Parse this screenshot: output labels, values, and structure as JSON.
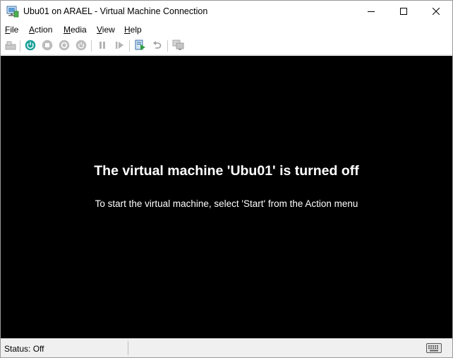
{
  "window": {
    "title": "Ubu01 on ARAEL - Virtual Machine Connection",
    "app_icon": "vm-connection-icon",
    "controls": [
      "minimize-icon",
      "maximize-icon",
      "close-icon"
    ]
  },
  "menu": {
    "items": [
      {
        "accel": "F",
        "rest": "ile"
      },
      {
        "accel": "A",
        "rest": "ction"
      },
      {
        "accel": "M",
        "rest": "edia"
      },
      {
        "accel": "V",
        "rest": "iew"
      },
      {
        "accel": "H",
        "rest": "elp"
      }
    ]
  },
  "toolbar": {
    "buttons": [
      {
        "icon": "ctrl-alt-del-icon",
        "enabled": false
      },
      {
        "icon": "start-icon",
        "enabled": true
      },
      {
        "icon": "turn-off-icon",
        "enabled": false
      },
      {
        "icon": "shut-down-icon",
        "enabled": false
      },
      {
        "icon": "save-icon",
        "enabled": false
      },
      {
        "icon": "pause-icon",
        "enabled": false
      },
      {
        "icon": "resume-icon",
        "enabled": false
      },
      {
        "icon": "checkpoint-icon",
        "enabled": true
      },
      {
        "icon": "revert-icon",
        "enabled": false
      },
      {
        "icon": "enhanced-session-icon",
        "enabled": false
      }
    ],
    "colors": {
      "start": "#1aa19a",
      "checkpoint": "#2e7d32",
      "disabled": "#b4b4b4"
    }
  },
  "screen": {
    "title": "The virtual machine 'Ubu01' is turned off",
    "subtitle": "To start the virtual machine, select 'Start' from the Action menu",
    "background": "#000000",
    "text_color": "#ffffff"
  },
  "status": {
    "text": "Status: Off",
    "keyboard_icon": "keyboard-icon"
  }
}
